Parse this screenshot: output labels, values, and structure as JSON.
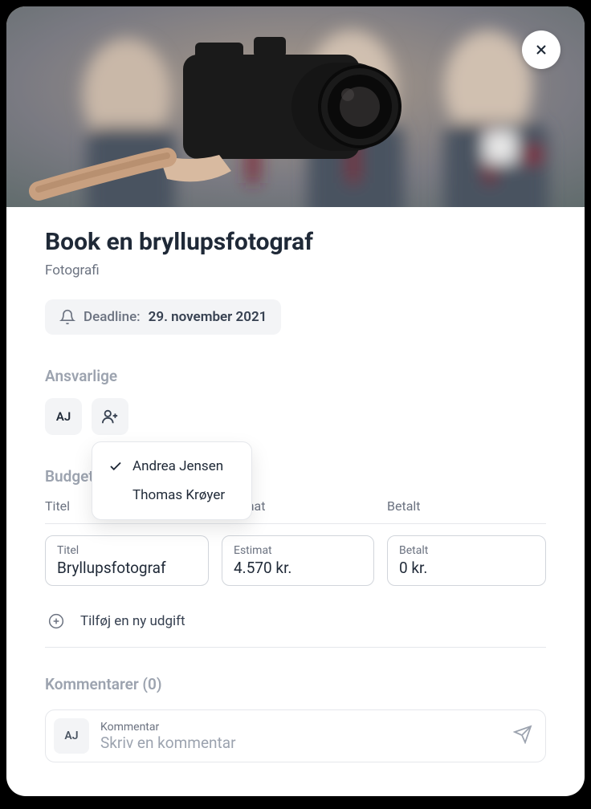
{
  "header": {
    "title": "Book en bryllupsfotograf",
    "category": "Fotografi",
    "deadline_label": "Deadline:",
    "deadline_date": "29. november 2021"
  },
  "assignees": {
    "section_label": "Ansvarlige",
    "avatar_initials": "AJ",
    "dropdown": [
      {
        "name": "Andrea Jensen",
        "selected": true
      },
      {
        "name": "Thomas Krøyer",
        "selected": false
      }
    ]
  },
  "budget": {
    "section_label": "Budget",
    "columns": {
      "title": "Titel",
      "estimate": "Estimat",
      "paid": "Betalt"
    },
    "row": {
      "title_label": "Titel",
      "title_value": "Bryllupsfotograf",
      "estimate_label": "Estimat",
      "estimate_value": "4.570 kr.",
      "paid_label": "Betalt",
      "paid_value": "0 kr."
    },
    "add_expense_label": "Tilføj en ny udgift"
  },
  "comments": {
    "section_label": "Kommentarer (0)",
    "avatar_initials": "AJ",
    "input_label": "Kommentar",
    "input_placeholder": "Skriv en kommentar"
  }
}
